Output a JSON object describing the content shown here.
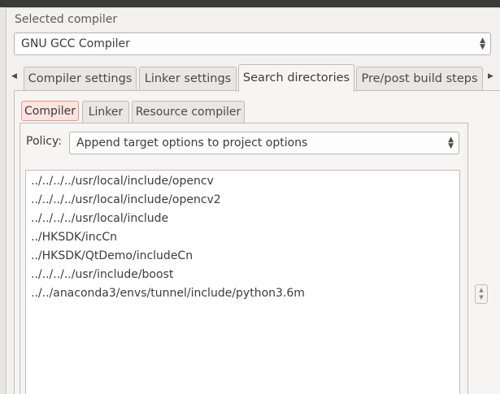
{
  "selected_compiler": {
    "label": "Selected compiler",
    "value": "GNU GCC Compiler"
  },
  "main_tabs": [
    {
      "label": "Compiler settings",
      "active": false
    },
    {
      "label": "Linker settings",
      "active": false
    },
    {
      "label": "Search directories",
      "active": true
    },
    {
      "label": "Pre/post build steps",
      "active": false
    }
  ],
  "sub_tabs": [
    {
      "label": "Compiler",
      "active": true
    },
    {
      "label": "Linker",
      "active": false
    },
    {
      "label": "Resource compiler",
      "active": false
    }
  ],
  "policy": {
    "label": "Policy:",
    "value": "Append target options to project options"
  },
  "directories": [
    "../../../../usr/local/include/opencv",
    "../../../../usr/local/include/opencv2",
    "../../../../usr/local/include",
    "../HKSDK/incCn",
    "../HKSDK/QtDemo/includeCn",
    "../../../../usr/include/boost",
    "../../anaconda3/envs/tunnel/include/python3.6m"
  ],
  "icons": {
    "tab_scroll_left": "◀",
    "tab_scroll_right": "▶",
    "combo_up": "▲",
    "combo_down": "▼"
  },
  "colors": {
    "window_bg": "#f2f1f0",
    "active_subtab_bg": "#fbe3df",
    "active_subtab_border": "#e89b8e"
  }
}
